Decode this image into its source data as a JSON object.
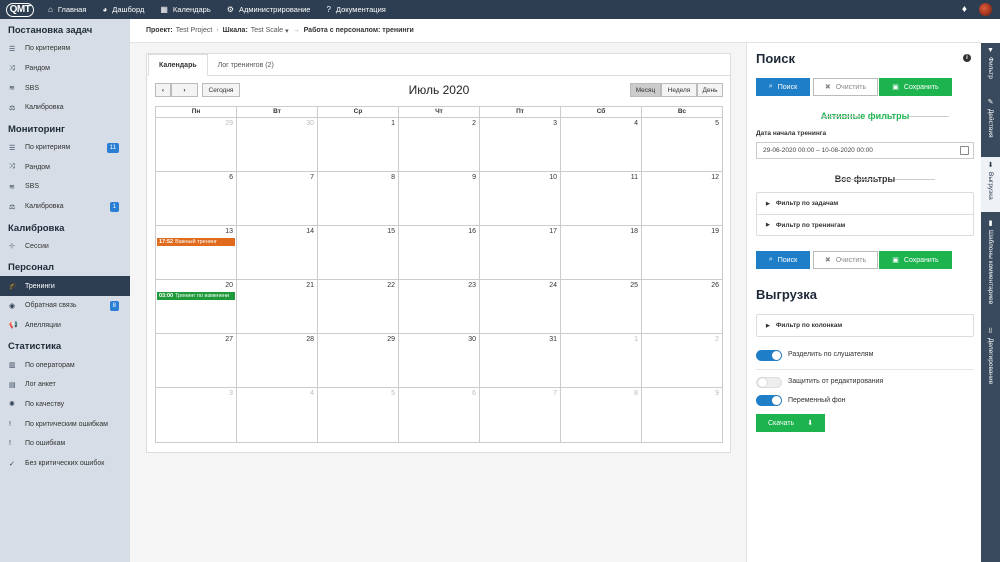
{
  "topbar": {
    "logo": "QMT",
    "nav": [
      {
        "icon": "⌂",
        "label": "Главная"
      },
      {
        "icon": "◕",
        "label": "Дашборд"
      },
      {
        "icon": "▦",
        "label": "Календарь"
      },
      {
        "icon": "⚙",
        "label": "Администрирование"
      },
      {
        "icon": "?",
        "label": "Документация"
      }
    ],
    "bell_icon": "🔔"
  },
  "sidebar": {
    "sections": [
      {
        "title": "Постановка задач",
        "items": [
          {
            "icon": "☰",
            "label": "По критериям"
          },
          {
            "icon": "⤨",
            "label": "Рандом"
          },
          {
            "icon": "≋",
            "label": "SBS"
          },
          {
            "icon": "⚖",
            "label": "Калибровка"
          }
        ]
      },
      {
        "title": "Мониторинг",
        "items": [
          {
            "icon": "☰",
            "label": "По критериям",
            "badge": "11"
          },
          {
            "icon": "⤨",
            "label": "Рандом"
          },
          {
            "icon": "≋",
            "label": "SBS"
          },
          {
            "icon": "⚖",
            "label": "Калибровка",
            "badge": "1"
          }
        ]
      },
      {
        "title": "Калибровка",
        "items": [
          {
            "icon": "⊹",
            "label": "Сессии"
          }
        ]
      },
      {
        "title": "Персонал",
        "items": [
          {
            "icon": "🎓",
            "label": "Тренинги",
            "active": true
          },
          {
            "icon": "◉",
            "label": "Обратная связь",
            "badge": "8"
          },
          {
            "icon": "📢",
            "label": "Апелляции"
          }
        ]
      },
      {
        "title": "Статистика",
        "items": [
          {
            "icon": "▥",
            "label": "По операторам"
          },
          {
            "icon": "▤",
            "label": "Лог анкет"
          },
          {
            "icon": "✺",
            "label": "По качеству"
          },
          {
            "icon": "!",
            "label": "По критическим ошибкам"
          },
          {
            "icon": "!",
            "label": "По ошибкам"
          },
          {
            "icon": "✓",
            "label": "Без критических ошибок"
          }
        ]
      }
    ]
  },
  "breadcrumb": {
    "project_label": "Проект:",
    "project": "Test Project",
    "scale_label": "Шкала:",
    "scale": "Test Scale",
    "page": "Работа с персоналом: тренинги"
  },
  "tabs": [
    {
      "label": "Календарь"
    },
    {
      "label": "Лог тренингов (2)"
    }
  ],
  "calendar": {
    "today_label": "Сегодня",
    "title": "Июль 2020",
    "views": [
      "Месяц",
      "Неделя",
      "День"
    ],
    "weekdays": [
      "Пн",
      "Вт",
      "Ср",
      "Чт",
      "Пт",
      "Сб",
      "Вс"
    ],
    "weeks": [
      [
        {
          "d": "29",
          "o": true
        },
        {
          "d": "30",
          "o": true
        },
        {
          "d": "1"
        },
        {
          "d": "2"
        },
        {
          "d": "3"
        },
        {
          "d": "4"
        },
        {
          "d": "5"
        }
      ],
      [
        {
          "d": "6"
        },
        {
          "d": "7"
        },
        {
          "d": "8"
        },
        {
          "d": "9"
        },
        {
          "d": "10"
        },
        {
          "d": "11"
        },
        {
          "d": "12"
        }
      ],
      [
        {
          "d": "13",
          "ev": {
            "time": "17:52",
            "title": "Важный тренинг",
            "color": "#e06a1e"
          }
        },
        {
          "d": "14"
        },
        {
          "d": "15"
        },
        {
          "d": "16"
        },
        {
          "d": "17"
        },
        {
          "d": "18"
        },
        {
          "d": "19"
        }
      ],
      [
        {
          "d": "20",
          "ev": {
            "time": "03:00",
            "title": "Тренинг по изменени",
            "color": "#1f9a3a"
          }
        },
        {
          "d": "21"
        },
        {
          "d": "22"
        },
        {
          "d": "23"
        },
        {
          "d": "24"
        },
        {
          "d": "25"
        },
        {
          "d": "26"
        }
      ],
      [
        {
          "d": "27"
        },
        {
          "d": "28"
        },
        {
          "d": "29"
        },
        {
          "d": "30"
        },
        {
          "d": "31"
        },
        {
          "d": "1",
          "o": true
        },
        {
          "d": "2",
          "o": true
        }
      ],
      [
        {
          "d": "3",
          "o": true
        },
        {
          "d": "4",
          "o": true
        },
        {
          "d": "5",
          "o": true
        },
        {
          "d": "6",
          "o": true
        },
        {
          "d": "7",
          "o": true
        },
        {
          "d": "8",
          "o": true
        },
        {
          "d": "9",
          "o": true
        }
      ]
    ]
  },
  "search": {
    "title": "Поиск",
    "search_label": "Поиск",
    "clear_label": "Очистить",
    "save_label": "Сохранить",
    "active_filters": "Активные фильтры",
    "date_label": "Дата начала тренинга",
    "date_value": "29-06-2020 00:00 – 10-08-2020 00:00",
    "all_filters": "Все фильтры",
    "filters": [
      "Фильтр по задачам",
      "Фильтр по тренингам"
    ]
  },
  "export": {
    "title": "Выгрузка",
    "filter": "Фильтр по колонкам",
    "toggles": [
      {
        "label": "Разделить по слушателям",
        "on": true
      },
      {
        "label": "Защитить от редактирования",
        "on": false
      },
      {
        "label": "Переменный фон",
        "on": true
      }
    ],
    "download_label": "Скачать"
  },
  "vtabs": [
    {
      "icon": "▼",
      "label": "Фильтр"
    },
    {
      "icon": "✎",
      "label": "Действия"
    },
    {
      "icon": "⬇",
      "label": "Выгрузка"
    },
    {
      "icon": "▮",
      "label": "Шаблоны комментариев"
    },
    {
      "icon": "⫫",
      "label": "Делегирование"
    }
  ],
  "colors": {
    "topbar": "#2e3e52",
    "sidebar": "#d7dde6",
    "blue": "#1f7ec8",
    "green": "#1db34f"
  }
}
